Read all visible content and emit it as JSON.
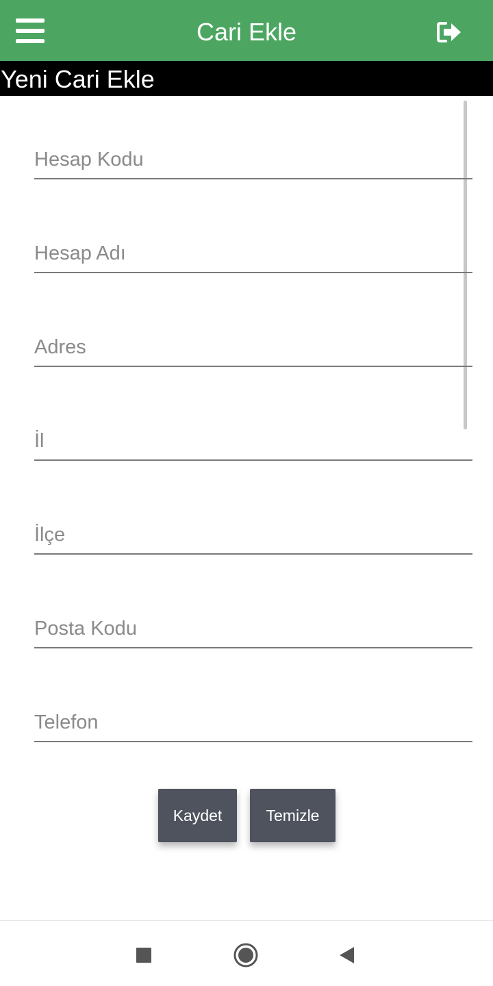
{
  "app_bar": {
    "title": "Cari Ekle",
    "menu_icon": "hamburger-menu-icon",
    "logout_icon": "sign-out-icon",
    "background_color": "#4ca662"
  },
  "subheader": {
    "title": "Yeni Cari Ekle"
  },
  "form": {
    "fields": [
      {
        "placeholder": "Hesap Kodu",
        "value": ""
      },
      {
        "placeholder": "Hesap Adı",
        "value": ""
      },
      {
        "placeholder": "Adres",
        "value": ""
      },
      {
        "placeholder": "İl",
        "value": ""
      },
      {
        "placeholder": "İlçe",
        "value": ""
      },
      {
        "placeholder": "Posta Kodu",
        "value": ""
      },
      {
        "placeholder": "Telefon",
        "value": ""
      }
    ],
    "save_label": "Kaydet",
    "clear_label": "Temizle",
    "button_color": "#4e535e"
  },
  "system_nav": {
    "recent_icon": "square-recent-apps-icon",
    "home_icon": "circle-home-icon",
    "back_icon": "triangle-back-icon"
  }
}
